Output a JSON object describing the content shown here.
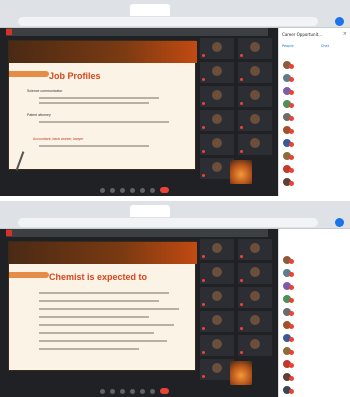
{
  "top": {
    "slide_title": "Job Profiles",
    "slide_lines": [
      "Science communicator",
      "Patent attorney",
      "Accountant, bank worker, lawyer"
    ],
    "panel_title": "Career Opportunit...",
    "panel_tab_people": "People",
    "panel_tab_chat": "Chat"
  },
  "bottom": {
    "slide_title": "Chemist is expected to"
  }
}
